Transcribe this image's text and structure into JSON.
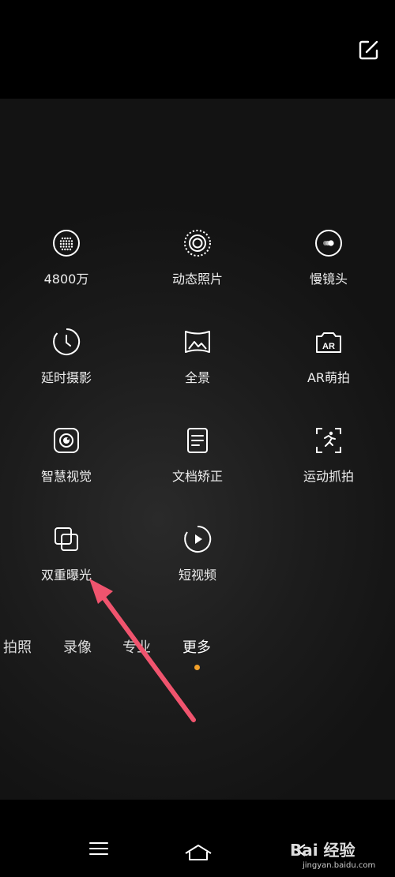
{
  "modes": [
    {
      "label": "4800万",
      "icon": "grid-lens-icon"
    },
    {
      "label": "动态照片",
      "icon": "live-photo-icon"
    },
    {
      "label": "慢镜头",
      "icon": "slow-motion-icon"
    },
    {
      "label": "延时摄影",
      "icon": "timelapse-icon"
    },
    {
      "label": "全景",
      "icon": "panorama-icon"
    },
    {
      "label": "AR萌拍",
      "icon": "ar-icon"
    },
    {
      "label": "智慧视觉",
      "icon": "smart-vision-icon"
    },
    {
      "label": "文档矫正",
      "icon": "document-icon"
    },
    {
      "label": "运动抓拍",
      "icon": "sport-capture-icon"
    },
    {
      "label": "双重曝光",
      "icon": "double-exposure-icon"
    },
    {
      "label": "短视频",
      "icon": "short-video-icon"
    }
  ],
  "tabs": [
    {
      "label": "拍照"
    },
    {
      "label": "录像"
    },
    {
      "label": "专业"
    },
    {
      "label": "更多"
    }
  ],
  "active_tab": "更多",
  "accent_color": "#f2a02a",
  "annotation_color": "#f0546e",
  "watermark": {
    "main": "Bai 经验",
    "sub": "jingyan.baidu.com"
  }
}
